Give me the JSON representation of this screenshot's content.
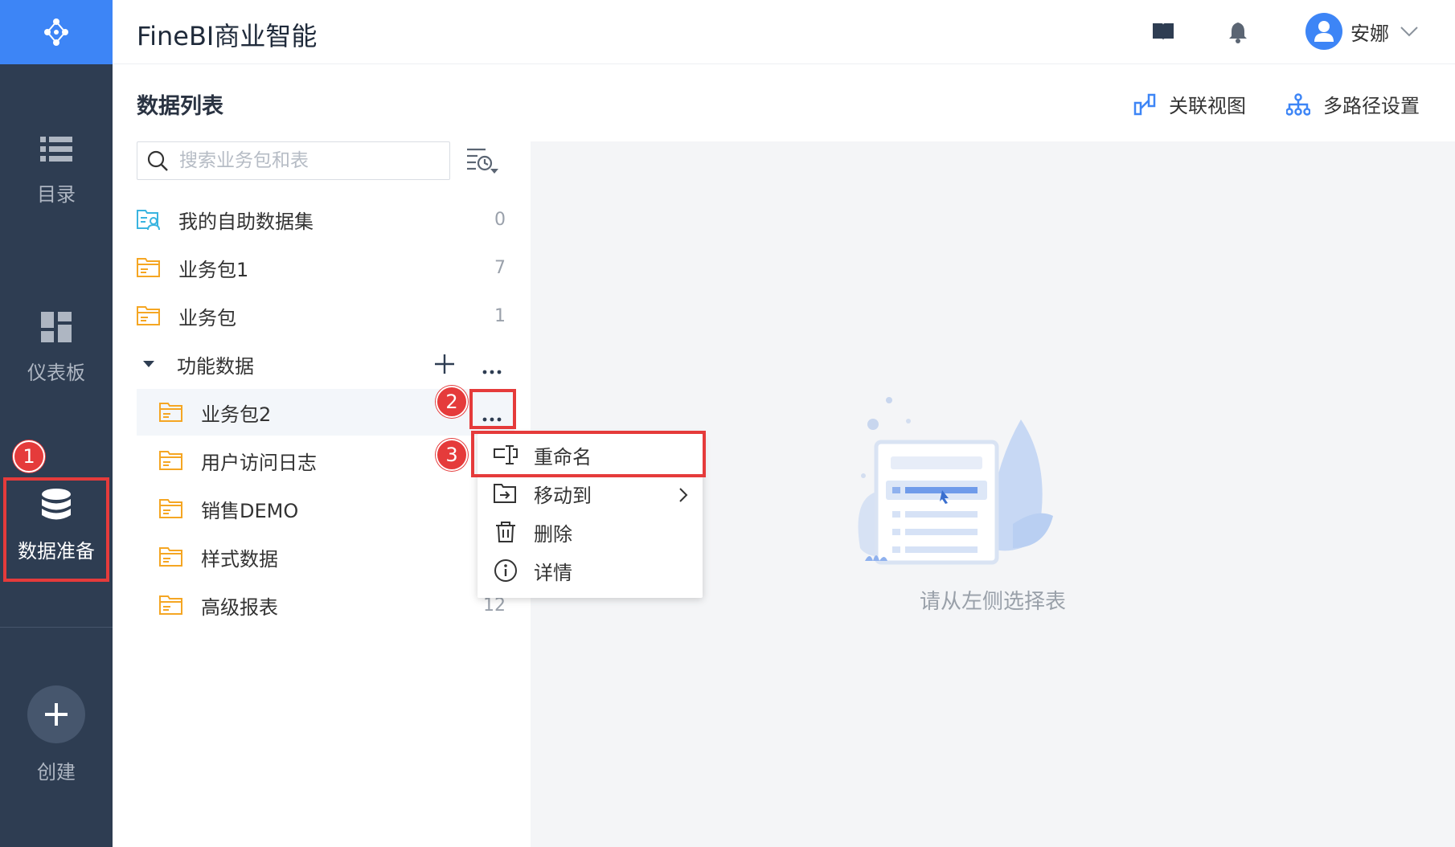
{
  "app": {
    "title": "FineBI商业智能"
  },
  "user": {
    "name": "安娜"
  },
  "nav": {
    "items": [
      {
        "label": "目录",
        "icon": "list-icon"
      },
      {
        "label": "仪表板",
        "icon": "dashboard-icon"
      },
      {
        "label": "数据准备",
        "icon": "database-icon",
        "active": true
      },
      {
        "label": "创建",
        "icon": "plus-icon"
      }
    ]
  },
  "page": {
    "title": "数据列表",
    "actions": {
      "relation_view": "关联视图",
      "multipath": "多路径设置"
    }
  },
  "search": {
    "placeholder": "搜索业务包和表"
  },
  "list": {
    "items": [
      {
        "name": "我的自助数据集",
        "count": "0"
      },
      {
        "name": "业务包1",
        "count": "7"
      },
      {
        "name": "业务包",
        "count": "1"
      }
    ],
    "group": {
      "name": "功能数据"
    },
    "children": [
      {
        "name": "业务包2"
      },
      {
        "name": "用户访问日志"
      },
      {
        "name": "销售DEMO"
      },
      {
        "name": "样式数据"
      },
      {
        "name": "高级报表",
        "count": "12"
      }
    ]
  },
  "menu": {
    "items": [
      {
        "label": "重命名",
        "icon": "rename-icon"
      },
      {
        "label": "移动到",
        "icon": "move-to-icon"
      },
      {
        "label": "删除",
        "icon": "trash-icon"
      },
      {
        "label": "详情",
        "icon": "info-icon"
      }
    ]
  },
  "empty_state": {
    "text": "请从左侧选择表"
  },
  "annotations": {
    "badge1": "1",
    "badge2": "2",
    "badge3": "3"
  },
  "colors": {
    "nav_bg": "#2e3d52",
    "accent": "#3d85f6",
    "folder": "#f5a623",
    "annotation": "#e53b3b"
  }
}
